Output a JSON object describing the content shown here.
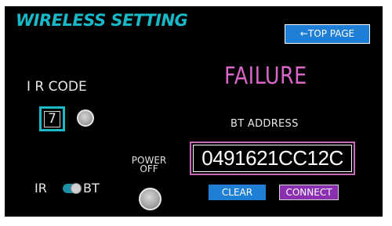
{
  "header": {
    "title": "WIRELESS SETTING",
    "top_page_button": "←TOP PAGE"
  },
  "status": {
    "text": "FAILURE",
    "color": "#d865c8"
  },
  "ir_code": {
    "label": "I R CODE",
    "value": "7"
  },
  "bt": {
    "label": "BT ADDRESS",
    "address": "0491621CC12C",
    "clear_button": "CLEAR",
    "connect_button": "CONNECT"
  },
  "power": {
    "label_line1": "POWER",
    "label_line2": "OFF"
  },
  "mode_switch": {
    "left_label": "IR",
    "right_label": "BT",
    "selected": "BT"
  },
  "colors": {
    "background": "#000000",
    "accent_cyan": "#18b8c8",
    "button_blue": "#1f7fd6",
    "button_purple": "#8a2fb0"
  }
}
